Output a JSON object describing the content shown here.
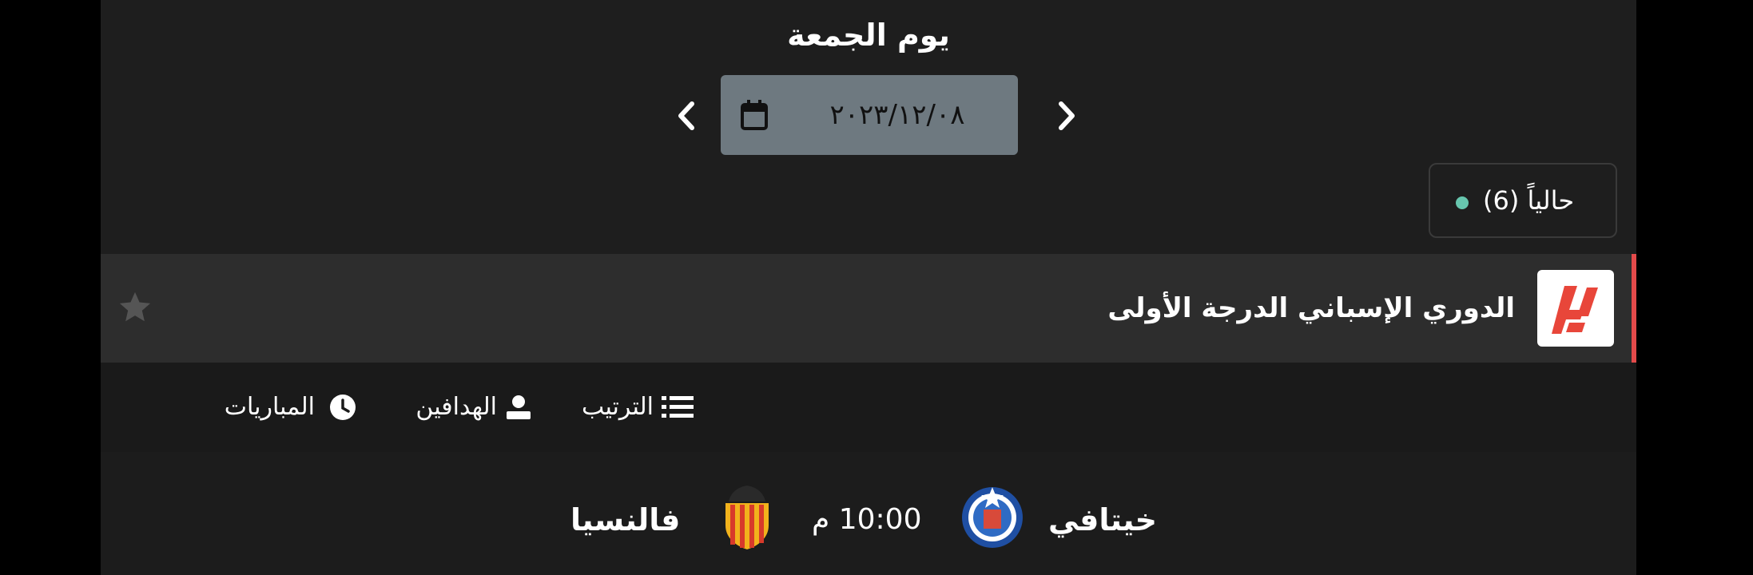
{
  "date_nav": {
    "day_label": "يوم الجمعة",
    "date_value": "٢٠٢٣/١٢/٠٨",
    "prev_icon": "chevron-left-icon",
    "next_icon": "chevron-right-icon",
    "calendar_icon": "calendar-icon"
  },
  "live_filter": {
    "label": "حالياً (6)",
    "dot_color": "#67c6ae"
  },
  "league": {
    "name": "الدوري الإسباني الدرجة الأولى",
    "accent_color": "#e34a4a",
    "logo_icon": "laliga-logo-icon",
    "favorite_icon": "star-icon"
  },
  "tabs": [
    {
      "label": "الترتيب",
      "icon": "list-icon"
    },
    {
      "label": "الهدافين",
      "icon": "user-icon"
    },
    {
      "label": "المباريات",
      "icon": "clock-icon"
    }
  ],
  "match": {
    "home_team": "خيتافي",
    "away_team": "فالنسيا",
    "time": "10:00 م",
    "home_crest_icon": "getafe-crest-icon",
    "away_crest_icon": "valencia-crest-icon"
  }
}
